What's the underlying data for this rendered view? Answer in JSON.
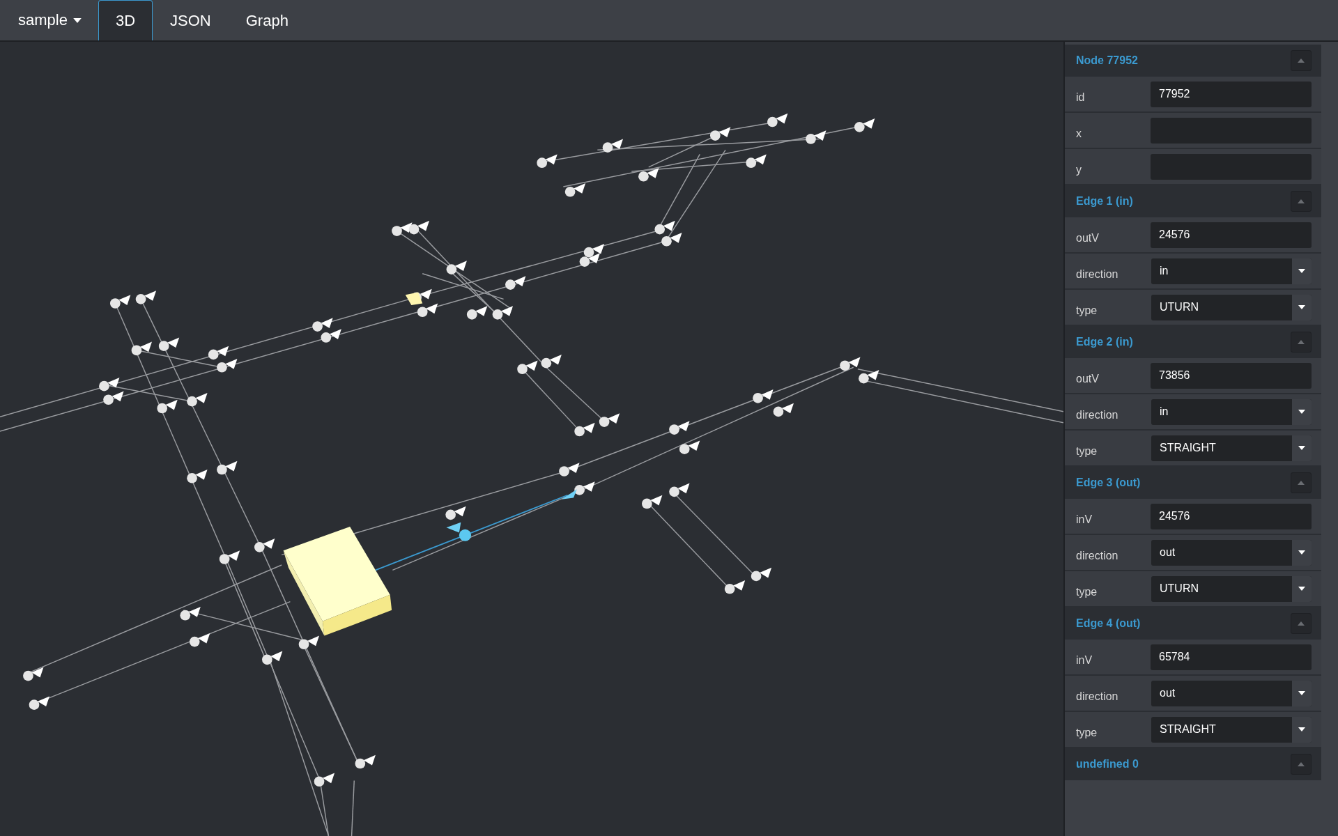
{
  "toolbar": {
    "dataset_menu": "sample"
  },
  "tabs": [
    {
      "label": "3D",
      "selected": true
    },
    {
      "label": "JSON",
      "selected": false
    },
    {
      "label": "Graph",
      "selected": false
    }
  ],
  "panel": {
    "sections": [
      {
        "title": "Node 77952",
        "fields": [
          {
            "label": "id",
            "kind": "text",
            "value": "77952"
          },
          {
            "label": "x",
            "kind": "text"
          },
          {
            "label": "y",
            "kind": "text"
          }
        ]
      },
      {
        "title": "Edge 1 (in)",
        "fields": [
          {
            "label": "outV",
            "kind": "text",
            "value": "24576"
          },
          {
            "label": "direction",
            "kind": "select",
            "value": "in"
          },
          {
            "label": "type",
            "kind": "select",
            "value": "UTURN"
          }
        ]
      },
      {
        "title": "Edge 2 (in)",
        "fields": [
          {
            "label": "outV",
            "kind": "text",
            "value": "73856"
          },
          {
            "label": "direction",
            "kind": "select",
            "value": "in"
          },
          {
            "label": "type",
            "kind": "select",
            "value": "STRAIGHT"
          }
        ]
      },
      {
        "title": "Edge 3 (out)",
        "fields": [
          {
            "label": "inV",
            "kind": "text",
            "value": "24576"
          },
          {
            "label": "direction",
            "kind": "select",
            "value": "out"
          },
          {
            "label": "type",
            "kind": "select",
            "value": "UTURN"
          }
        ]
      },
      {
        "title": "Edge 4 (out)",
        "fields": [
          {
            "label": "inV",
            "kind": "text",
            "value": "65784"
          },
          {
            "label": "direction",
            "kind": "select",
            "value": "out"
          },
          {
            "label": "type",
            "kind": "select",
            "value": "STRAIGHT"
          }
        ]
      },
      {
        "title": "undefined 0"
      }
    ]
  }
}
